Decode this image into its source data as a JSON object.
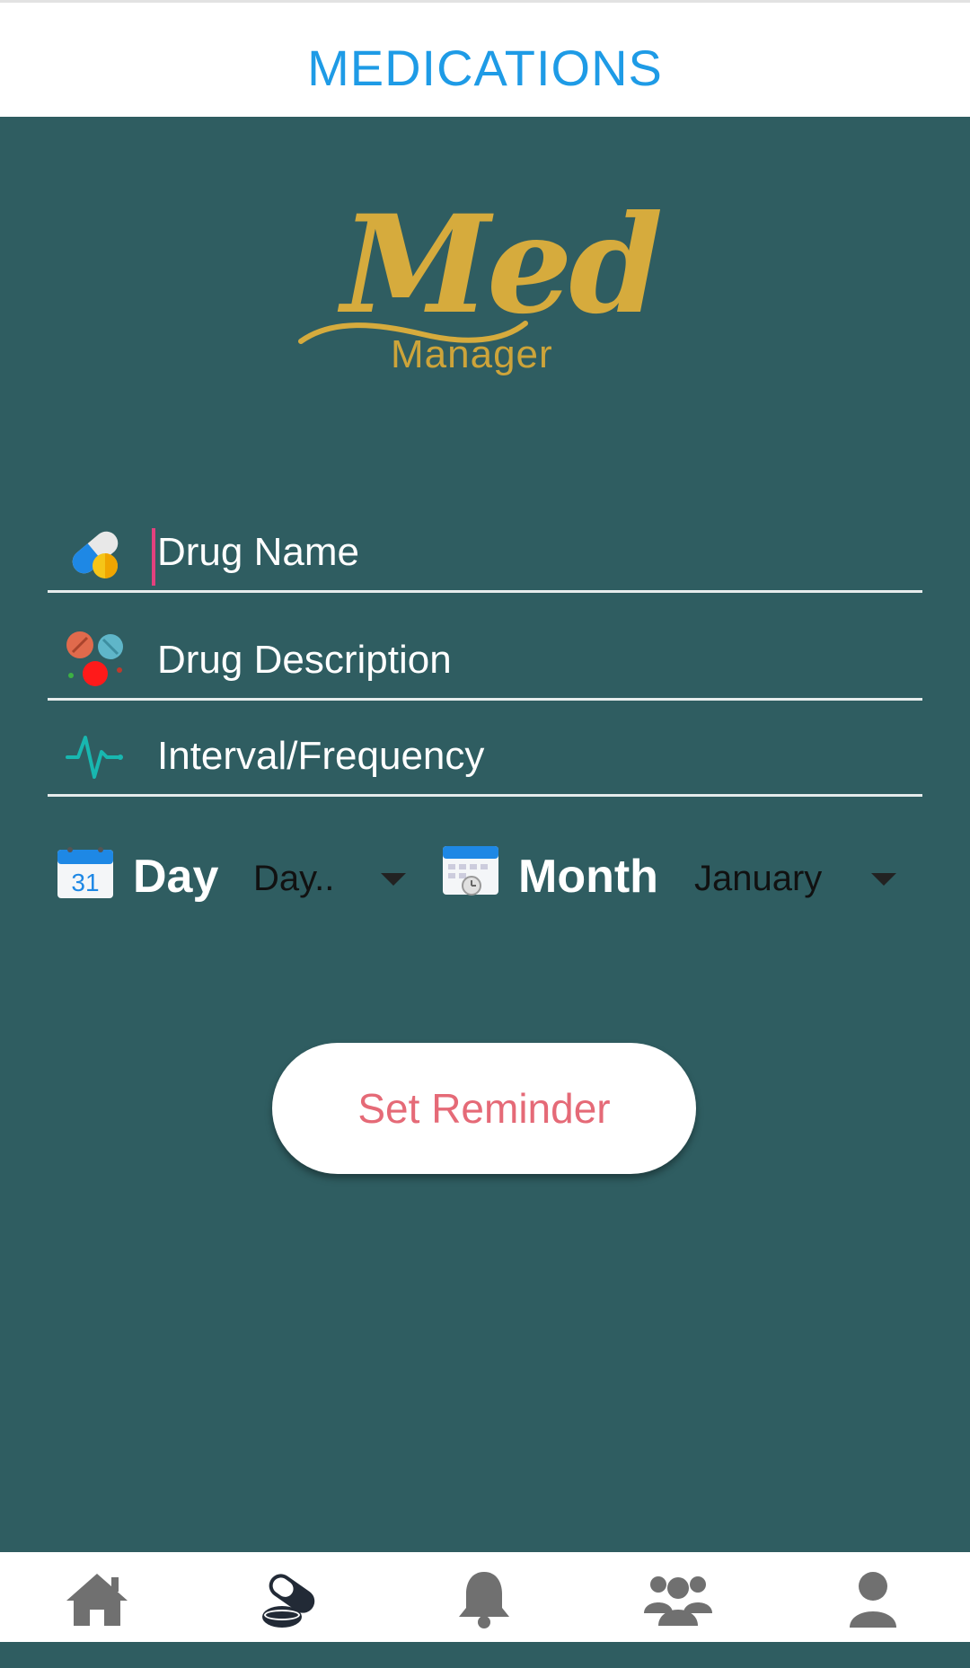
{
  "app_bar": {
    "title": "MEDICATIONS"
  },
  "logo": {
    "script": "Med",
    "sub": "Manager"
  },
  "form": {
    "drug_name": {
      "placeholder": "Drug Name",
      "icon": "capsule-icon"
    },
    "drug_description": {
      "placeholder": "Drug Description",
      "icon": "pills-icon"
    },
    "interval": {
      "placeholder": "Interval/Frequency",
      "icon": "pulse-icon"
    }
  },
  "pickers": {
    "day": {
      "label": "Day",
      "value": "Day..",
      "icon": "calendar-31-icon"
    },
    "month": {
      "label": "Month",
      "value": "January",
      "icon": "calendar-clock-icon"
    }
  },
  "actions": {
    "set_reminder": "Set Reminder"
  },
  "bottom_nav": {
    "items": [
      {
        "name": "home",
        "icon": "home-icon",
        "active": false
      },
      {
        "name": "medications",
        "icon": "pills-icon",
        "active": true
      },
      {
        "name": "reminders",
        "icon": "bell-icon",
        "active": false
      },
      {
        "name": "groups",
        "icon": "group-icon",
        "active": false
      },
      {
        "name": "profile",
        "icon": "user-icon",
        "active": false
      }
    ]
  },
  "colors": {
    "background": "#2f5d61",
    "title": "#1e9be6",
    "gold": "#d6ab3d",
    "button_text": "#e56a77",
    "nav_active": "#222a36",
    "nav_inactive": "#707070"
  }
}
